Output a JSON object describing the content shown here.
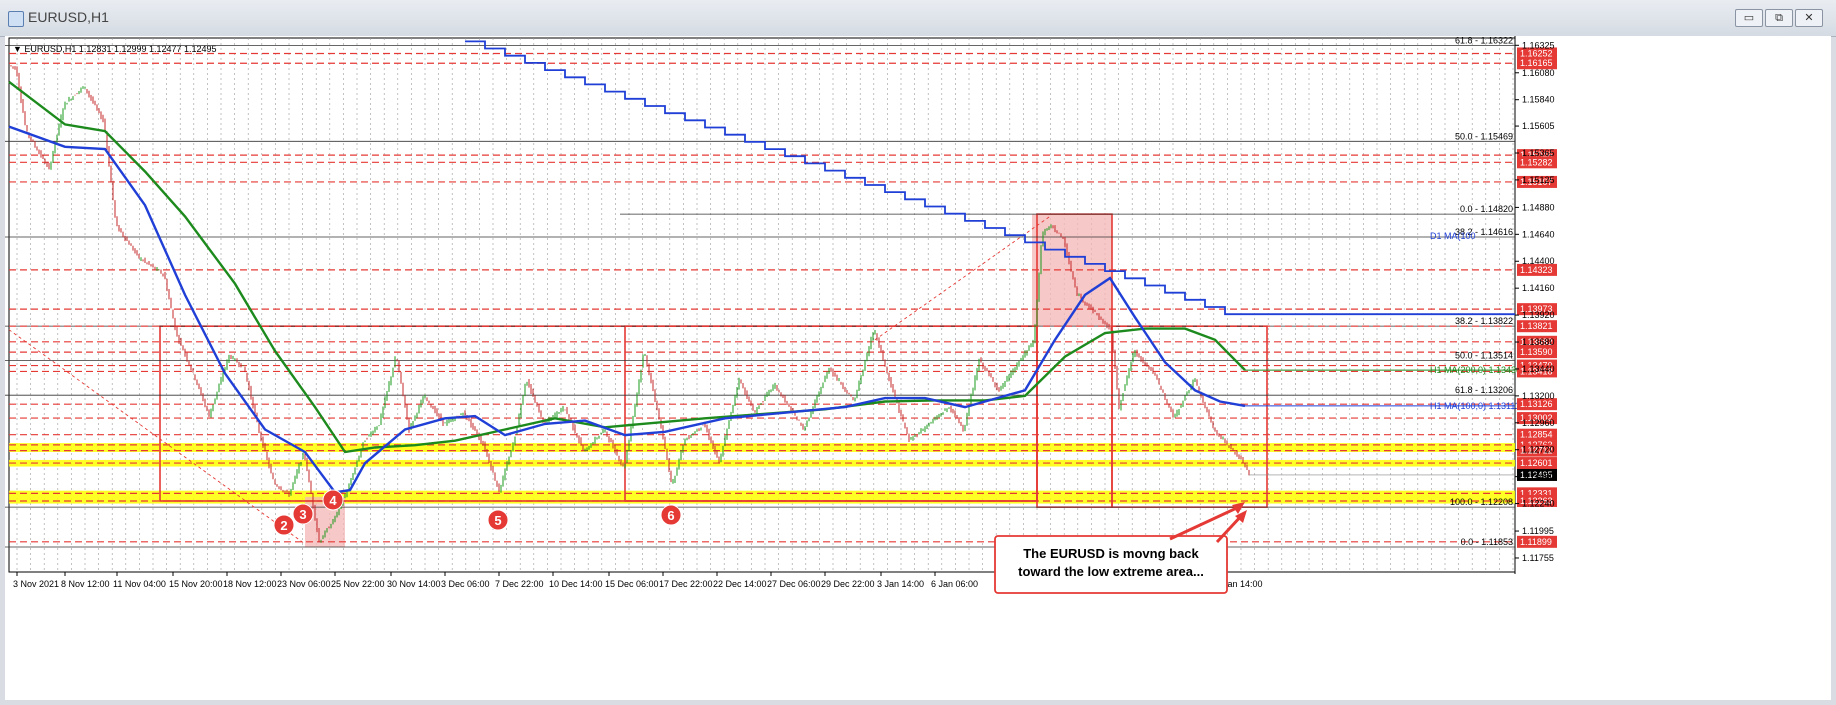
{
  "window": {
    "title": "EURUSD,H1",
    "minimize": "▭",
    "restore": "⧉",
    "close": "✕"
  },
  "chart_data": {
    "type": "candlestick",
    "symbol_label": "EURUSD,H1",
    "ohlc_header": "1.12831 1.12999 1.12477 1.12495",
    "ylim": [
      1.1163,
      1.1639
    ],
    "price_ticks": [
      "1.16325",
      "1.16080",
      "1.15840",
      "1.15605",
      "1.15365",
      "1.15125",
      "1.14880",
      "1.14640",
      "1.14400",
      "1.14160",
      "1.13920",
      "1.13680",
      "1.13440",
      "1.13200",
      "1.12960",
      "1.12720",
      "1.12480",
      "1.12240",
      "1.11995",
      "1.11755"
    ],
    "time_ticks": [
      "3 Nov 2021",
      "8 Nov 12:00",
      "11 Nov 04:00",
      "15 Nov 20:00",
      "18 Nov 12:00",
      "23 Nov 06:00",
      "25 Nov 22:00",
      "30 Nov 14:00",
      "3 Dec 06:00",
      "7 Dec 22:00",
      "10 Dec 14:00",
      "15 Dec 06:00",
      "17 Dec 22:00",
      "22 Dec 14:00",
      "27 Dec 06:00",
      "29 Dec 22:00",
      "3 Jan 14:00",
      "6 Jan 06:00",
      "Jan 14:00"
    ],
    "red_levels": [
      "1.16252",
      "1.16165",
      "1.15346",
      "1.15282",
      "1.15107",
      "1.14323",
      "1.13973",
      "1.13821",
      "1.13682",
      "1.13590",
      "1.13470",
      "1.13418",
      "1.13126",
      "1.13002",
      "1.12854",
      "1.12763",
      "1.12712",
      "1.12601",
      "1.12331",
      "1.12263",
      "1.11899"
    ],
    "current_price": "1.12495",
    "fib_levels": [
      {
        "label": "61.8 - 1.16322",
        "price": 1.16322
      },
      {
        "label": "50.0 - 1.15469",
        "price": 1.15469
      },
      {
        "label": "0.0 - 1.14820",
        "price": 1.1482
      },
      {
        "label": "38.2 - 1.14616",
        "price": 1.14616
      },
      {
        "label": "38.2 - 1.13822",
        "price": 1.13822
      },
      {
        "label": "50.0 - 1.13514",
        "price": 1.13514
      },
      {
        "label": "61.8 - 1.13206",
        "price": 1.13206
      },
      {
        "label": "100.0 - 1.12208",
        "price": 1.12208
      },
      {
        "label": "0.0 - 1.11853",
        "price": 1.11853
      }
    ],
    "ma_labels": [
      "D1 MA(100",
      "H1 MA(200,0) 1.13430",
      "H1 MA(100,0) 1.13111"
    ],
    "markers": [
      "2",
      "3",
      "4",
      "5",
      "6"
    ],
    "annotation": [
      "The EURUSD is movng back",
      "toward the low extreme area..."
    ],
    "colors": {
      "price": "#1a9a1a",
      "bear": "#c62828",
      "ma100": "#1f3fd6",
      "ma200": "#1d8a1d",
      "level": "#e53935",
      "yellow": "#ffff00",
      "marker": "#e53935"
    }
  }
}
